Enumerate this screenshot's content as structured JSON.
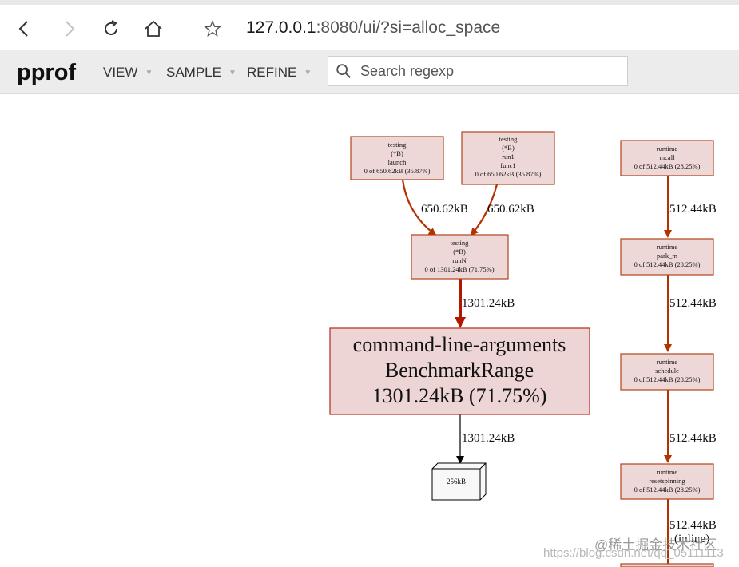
{
  "browser": {
    "url_host": "127.0.0.1",
    "url_rest": ":8080/ui/?si=alloc_space",
    "icons": [
      "back-icon",
      "forward-icon",
      "reload-icon",
      "home-icon",
      "star-icon"
    ]
  },
  "pprof": {
    "title": "pprof",
    "menu": [
      {
        "label": "VIEW"
      },
      {
        "label": "SAMPLE"
      },
      {
        "label": "REFINE"
      }
    ],
    "search_placeholder": "Search regexp"
  },
  "graph": {
    "nodes": {
      "launch": [
        "testing",
        "(*B)",
        "launch",
        "0 of 650.62kB (35.87%)"
      ],
      "run1": [
        "testing",
        "(*B)",
        "run1",
        "func1",
        "0 of 650.62kB (35.87%)"
      ],
      "mcall": [
        "runtime",
        "mcall",
        "0 of 512.44kB (28.25%)"
      ],
      "runN": [
        "testing",
        "(*B)",
        "runN",
        "0 of 1301.24kB (71.75%)"
      ],
      "park_m": [
        "runtime",
        "park_m",
        "0 of 512.44kB (28.25%)"
      ],
      "bench": [
        "command-line-arguments",
        "BenchmarkRange",
        "1301.24kB (71.75%)"
      ],
      "schedule": [
        "runtime",
        "schedule",
        "0 of 512.44kB (28.25%)"
      ],
      "alloc": [
        "256kB"
      ],
      "resetspinning": [
        "runtime",
        "resetspinning",
        "0 of 512.44kB (28.25%)"
      ]
    },
    "edges": {
      "launch_runN": "650.62kB",
      "run1_runN": "650.62kB",
      "mcall_park": "512.44kB",
      "runN_bench": "1301.24kB",
      "park_schedule": "512.44kB",
      "bench_alloc": "1301.24kB",
      "schedule_reset": "512.44kB",
      "reset_next": "512.44kB",
      "reset_next_note": "(inline)"
    }
  },
  "watermark": {
    "line1": "@稀土掘金技术社区",
    "line2": "https://blog.csdn.net/qq_05111113"
  },
  "colors": {
    "edge_main": "#b23200",
    "edge_heavy": "#b21800",
    "node_fill": "#edd8d7",
    "node_stroke": "#b2431c"
  }
}
